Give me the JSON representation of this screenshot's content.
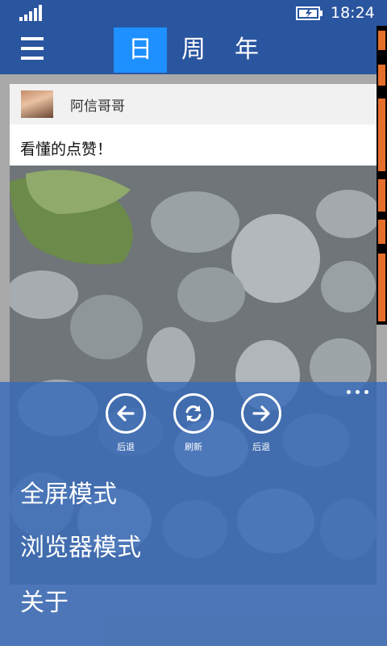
{
  "status_bar": {
    "time": "18:24"
  },
  "tabs": [
    {
      "label": "日",
      "active": true
    },
    {
      "label": "周",
      "active": false
    },
    {
      "label": "年",
      "active": false
    }
  ],
  "post": {
    "author": "阿信哥哥",
    "text": "看懂的点赞！"
  },
  "actions": [
    {
      "label": "后退",
      "icon": "arrow-left-icon"
    },
    {
      "label": "刷新",
      "icon": "refresh-icon"
    },
    {
      "label": "后退",
      "icon": "arrow-right-icon"
    }
  ],
  "menu": {
    "fullscreen": "全屏模式",
    "browser": "浏览器模式",
    "about": "关于"
  },
  "colors": {
    "accent": "#2a559f",
    "tab_active": "#1e90ff"
  }
}
